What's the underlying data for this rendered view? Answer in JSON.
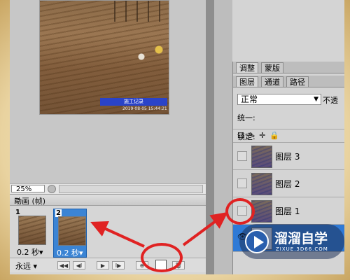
{
  "photo": {
    "stamp_title": "施工记录",
    "timestamp": "2019-08-05 15:44:21"
  },
  "status": {
    "zoom": "25%"
  },
  "animation": {
    "title": "动画 (帧)",
    "frames": [
      {
        "number": "1",
        "delay": "0.2 秒▾",
        "selected": false
      },
      {
        "number": "2",
        "delay": "0.2 秒▾",
        "selected": true
      }
    ],
    "loop": "永远",
    "controls": [
      "◀◀",
      "◀I",
      "▶",
      "I▶",
      "⊕"
    ]
  },
  "panel_tabs_top": [
    "调整",
    "蒙版"
  ],
  "panel_tabs_layers": [
    "图层",
    "通道",
    "路径"
  ],
  "layers": {
    "blend_mode": "正常",
    "opacity_label": "不透",
    "unify_label": "统一:",
    "lock_label": "锁定:",
    "items": [
      {
        "name": "图层 3"
      },
      {
        "name": "图层 2"
      },
      {
        "name": "图层 1"
      }
    ]
  },
  "watermark": {
    "title": "溜溜自学",
    "url": "ZIXUE.3D66.COM"
  },
  "colors": {
    "annotation": "#e02222",
    "selection": "#3b84d4"
  }
}
